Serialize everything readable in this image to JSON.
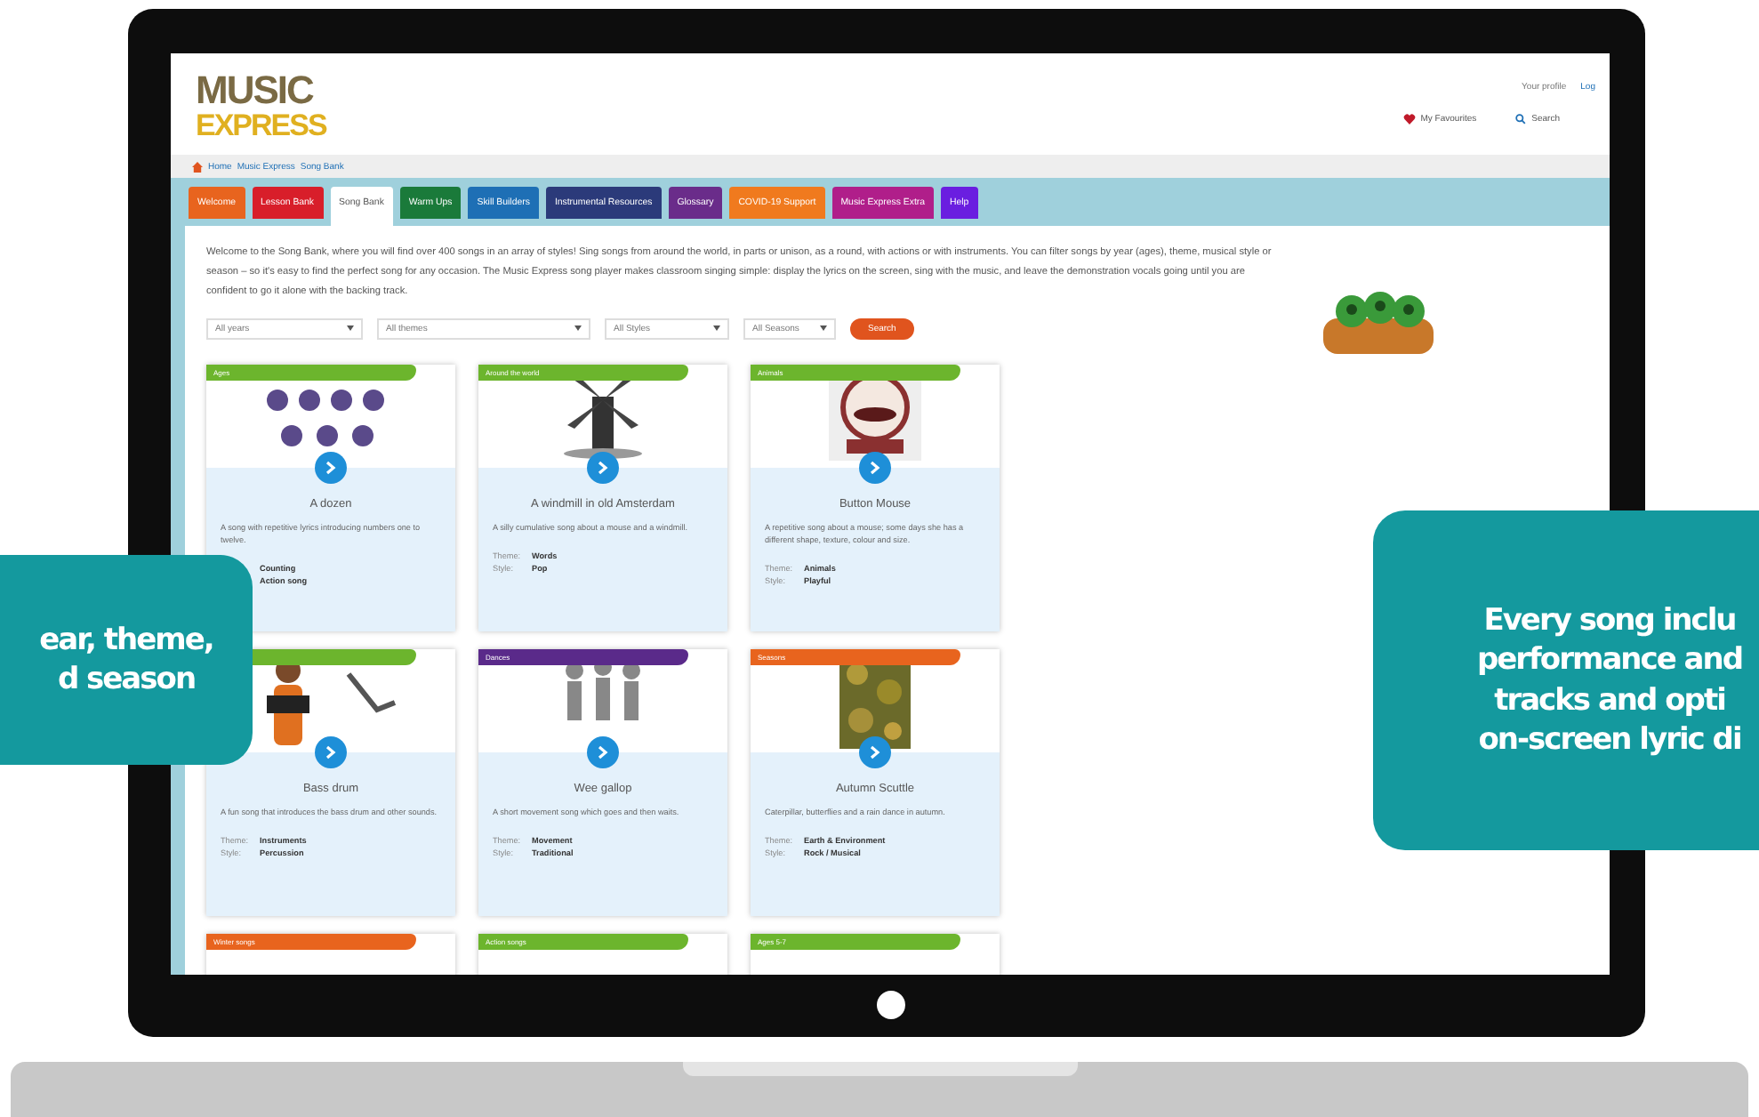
{
  "logo": {
    "line1": "MUSIC",
    "line2": "EXPRESS"
  },
  "account_links": [
    "Your profile",
    "Log"
  ],
  "favourites": "My Favourites",
  "search": "Search",
  "breadcrumb": [
    "Home",
    "Music Express",
    "Song Bank"
  ],
  "tabs": [
    {
      "label": "Welcome",
      "color": "#e8641e",
      "selected": false
    },
    {
      "label": "Lesson Bank",
      "color": "#d81e2a",
      "selected": false
    },
    {
      "label": "Song Bank",
      "color": "#ffffff",
      "selected": true
    },
    {
      "label": "Warm Ups",
      "color": "#1a7a3a",
      "selected": false
    },
    {
      "label": "Skill Builders",
      "color": "#1e6fb5",
      "selected": false
    },
    {
      "label": "Instrumental Resources",
      "color": "#2b3a7a",
      "selected": false
    },
    {
      "label": "Glossary",
      "color": "#6a2c8a",
      "selected": false
    },
    {
      "label": "COVID-19 Support",
      "color": "#f07a1e",
      "selected": false
    },
    {
      "label": "Music Express Extra",
      "color": "#b01e8a",
      "selected": false
    },
    {
      "label": "Help",
      "color": "#6a1ee0",
      "selected": false
    }
  ],
  "intro": "Welcome to the Song Bank, where you will find over 400 songs in an array of styles! Sing songs from around the world, in parts or unison, as a round, with actions or with instruments. You can filter songs by year (ages), theme, musical style or season – so it's easy to find the perfect song for any occasion. The Music Express song player makes classroom singing simple: display the lyrics on the screen, sing with the music, and leave the demonstration vocals going until you are confident to go it alone with the backing track.",
  "filters": [
    {
      "value": "All years"
    },
    {
      "value": "All themes"
    },
    {
      "value": "All Styles"
    },
    {
      "value": "All Seasons"
    }
  ],
  "search_button": "Search",
  "cards": [
    {
      "tag": "Ages",
      "color": "#6cb52d",
      "title": "A dozen",
      "description": "A song with repetitive lyrics introducing numbers one to twelve.",
      "meta": [
        {
          "value": "Counting"
        },
        {
          "value": "Action song"
        }
      ]
    },
    {
      "tag": "Around the world",
      "color": "#6cb52d",
      "title": "A windmill in old Amsterdam",
      "description": "A silly cumulative song about a mouse and a windmill.",
      "meta": [
        {
          "label": "Theme:",
          "value": "Words"
        },
        {
          "label": "Style:",
          "value": "Pop"
        }
      ]
    },
    {
      "tag": "Animals",
      "color": "#6cb52d",
      "title": "Button Mouse",
      "description": "A repetitive song about a mouse; some days she has a different shape, texture, colour and size.",
      "meta": [
        {
          "label": "Theme:",
          "value": "Animals"
        },
        {
          "label": "Style:",
          "value": "Playful"
        }
      ]
    },
    {
      "color": "#6cb52d",
      "title": "Bass drum",
      "description": "A fun song that introduces the bass drum and other sounds.",
      "meta": [
        {
          "label": "Theme:",
          "value": "Instruments"
        },
        {
          "label": "Style:",
          "value": "Percussion"
        }
      ]
    },
    {
      "tag": "Dances",
      "color": "#5a2a8a",
      "title": "Wee gallop",
      "description": "A short movement song which goes and then waits.",
      "meta": [
        {
          "label": "Theme:",
          "value": "Movement"
        },
        {
          "label": "Style:",
          "value": "Traditional"
        }
      ]
    },
    {
      "tag": "Seasons",
      "color": "#e8641e",
      "title": "Autumn Scuttle",
      "description": "Caterpillar, butterflies and a rain dance in autumn.",
      "meta": [
        {
          "label": "Theme:",
          "value": "Earth & Environment"
        },
        {
          "label": "Style:",
          "value": "Rock / Musical"
        }
      ]
    },
    {
      "tag": "Winter songs",
      "color": "#e8641e"
    },
    {
      "tag": "Action songs",
      "color": "#6cb52d"
    },
    {
      "tag": "Ages 5-7",
      "color": "#6cb52d"
    }
  ],
  "callouts": [
    {
      "lines": [
        "ear, theme,",
        "d season"
      ]
    },
    {
      "lines": [
        "Every song inclu",
        "performance and",
        "tracks and opti",
        "on-screen lyric di"
      ]
    }
  ]
}
